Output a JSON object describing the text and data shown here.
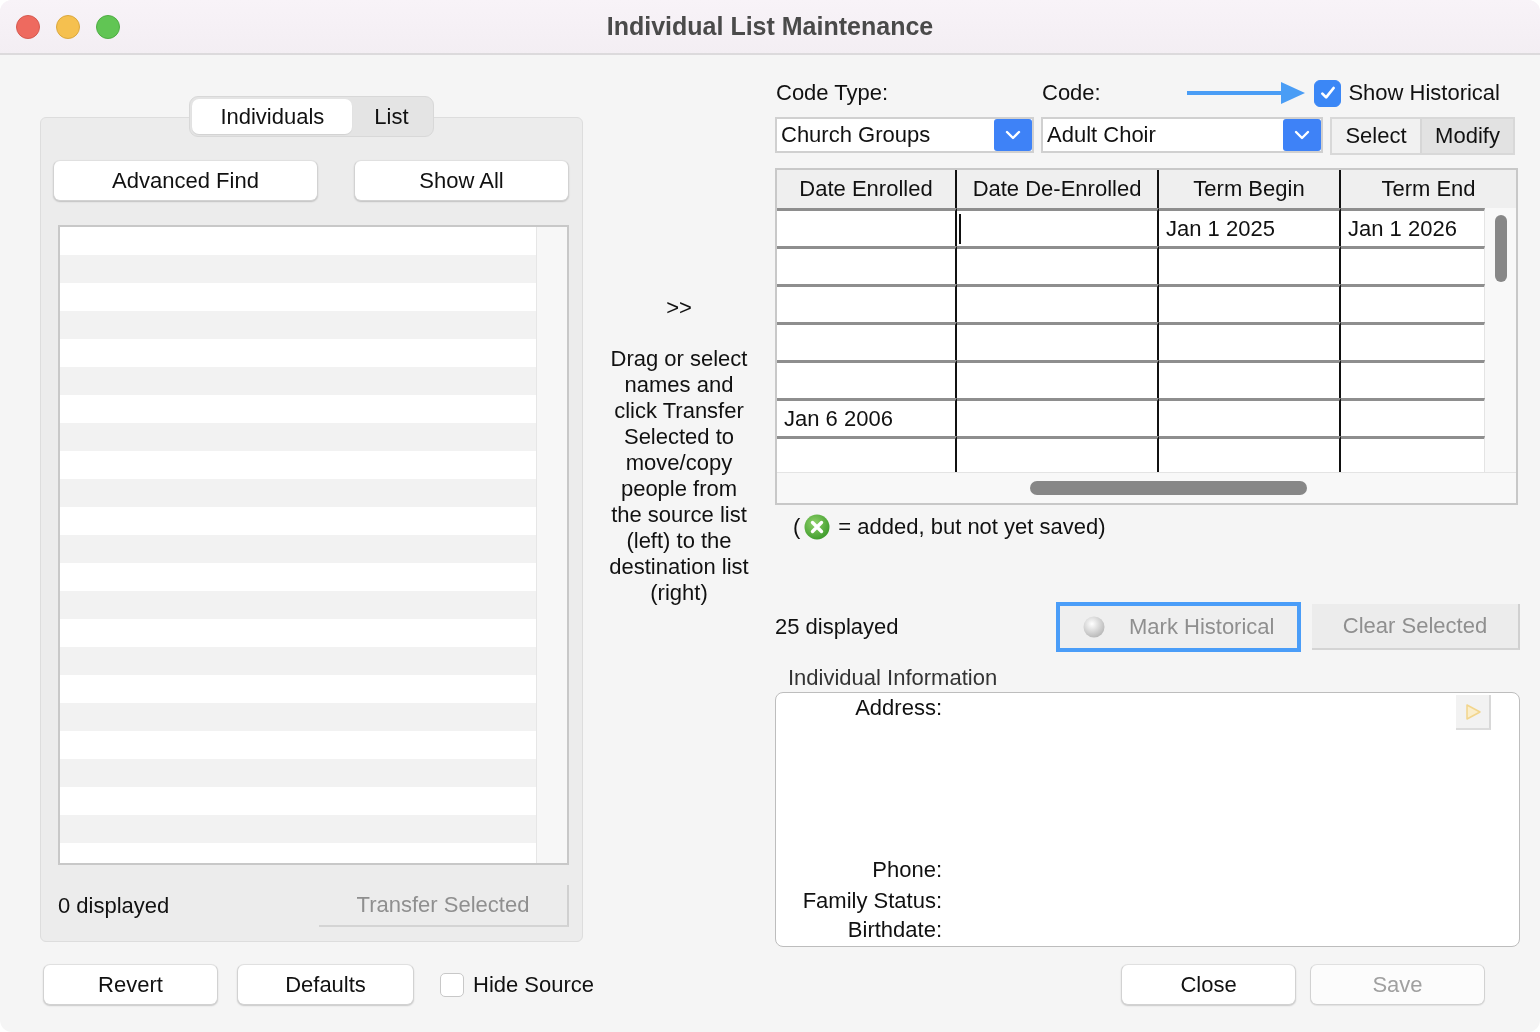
{
  "window": {
    "title": "Individual List Maintenance"
  },
  "source": {
    "tabs": [
      {
        "label": "Individuals",
        "selected": true
      },
      {
        "label": "List",
        "selected": false
      }
    ],
    "buttons": [
      {
        "label": "Advanced Find",
        "disabled": false
      },
      {
        "label": "Show All",
        "disabled": false
      }
    ],
    "count": "0 displayed",
    "transfer_button": {
      "label": "Transfer Selected",
      "disabled": true
    }
  },
  "transfer": {
    "arrows": ">>",
    "hint": "Drag or select names and click Transfer Selected to move/copy people from the source list (left) to the destination list (right)"
  },
  "destination": {
    "code_type": {
      "label": "Code Type:",
      "value": "Church Groups"
    },
    "code": {
      "label": "Code:",
      "value": "Adult Choir"
    },
    "show_historical": {
      "label": "Show Historical",
      "checked": true
    },
    "mode": [
      {
        "label": "Select",
        "selected": false
      },
      {
        "label": "Modify",
        "selected": true
      }
    ],
    "table": {
      "columns": [
        "Date Enrolled",
        "Date De-Enrolled",
        "Term Begin",
        "Term End"
      ],
      "rows": [
        {
          "cells": [
            {
              "editing": false
            },
            {
              "editing": true
            },
            {
              "text": "Jan 1 2025",
              "editing": false
            },
            {
              "text": "Jan 1 2026",
              "editing": false
            }
          ]
        },
        {
          "cells": [
            {
              "editing": false
            },
            {
              "editing": false
            },
            {
              "editing": false
            },
            {
              "editing": false
            }
          ]
        },
        {
          "cells": [
            {
              "editing": false
            },
            {
              "editing": false
            },
            {
              "editing": false
            },
            {
              "editing": false
            }
          ]
        },
        {
          "cells": [
            {
              "editing": false
            },
            {
              "editing": false
            },
            {
              "editing": false
            },
            {
              "editing": false
            }
          ]
        },
        {
          "cells": [
            {
              "editing": false
            },
            {
              "editing": false
            },
            {
              "editing": false
            },
            {
              "editing": false
            }
          ]
        },
        {
          "cells": [
            {
              "text": "Jan 6 2006",
              "editing": false
            },
            {
              "editing": false
            },
            {
              "editing": false
            },
            {
              "editing": false
            }
          ]
        },
        {
          "cells": [
            {
              "editing": false
            },
            {
              "editing": false
            },
            {
              "editing": false
            },
            {
              "editing": false
            }
          ]
        }
      ]
    },
    "legend": {
      "open": "(",
      "text": "= added, but not yet saved)"
    },
    "count": "25 displayed",
    "actions": [
      {
        "label": "Mark Historical",
        "disabled": true,
        "focused": true,
        "has_icon": true
      },
      {
        "label": "Clear Selected",
        "disabled": true,
        "focused": false,
        "has_icon": false
      }
    ],
    "info": {
      "title": "Individual Information",
      "fields": [
        {
          "label": "Address:",
          "kind": "multiline"
        },
        {
          "label": "Phone:",
          "kind": "line"
        },
        {
          "label": "Family Status:",
          "kind": "line"
        },
        {
          "label": "Birthdate:",
          "kind": "line"
        }
      ],
      "play_button": {
        "disabled": true
      }
    }
  },
  "footer": {
    "left_buttons": [
      {
        "label": "Revert",
        "disabled": false
      },
      {
        "label": "Defaults",
        "disabled": false
      }
    ],
    "hide_source": {
      "label": "Hide Source",
      "checked": false
    },
    "right_buttons": [
      {
        "label": "Close",
        "disabled": false
      },
      {
        "label": "Save",
        "disabled": true
      }
    ]
  }
}
